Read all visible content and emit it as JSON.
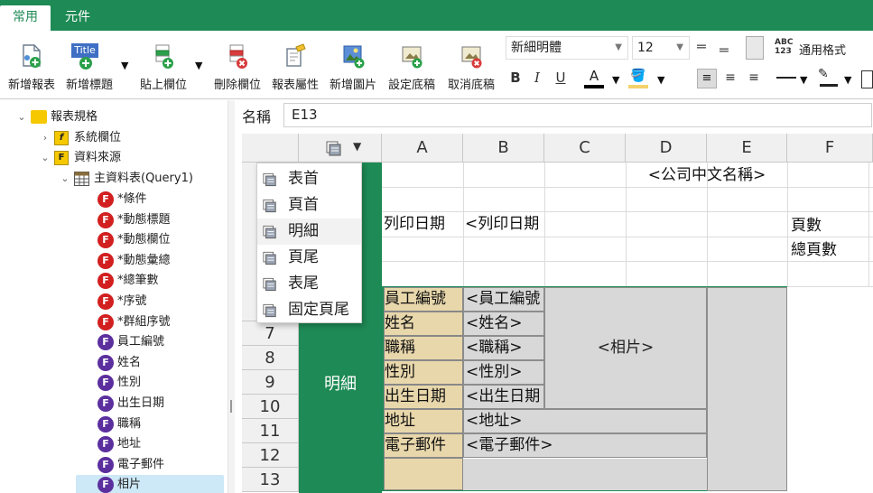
{
  "tabs": [
    {
      "label": "常用",
      "active": true
    },
    {
      "label": "元件",
      "active": false
    }
  ],
  "ribbon": {
    "buttons": [
      {
        "label": "新增報表",
        "icon": "new-report-icon"
      },
      {
        "label": "新增標題",
        "icon": "new-title-icon",
        "icon_text": "Title"
      },
      {
        "label": "貼上欄位",
        "icon": "paste-field-icon"
      },
      {
        "label": "刪除欄位",
        "icon": "delete-field-icon"
      },
      {
        "label": "報表屬性",
        "icon": "report-properties-icon"
      },
      {
        "label": "新增圖片",
        "icon": "add-image-icon"
      },
      {
        "label": "設定底稿",
        "icon": "set-template-icon"
      },
      {
        "label": "取消底稿",
        "icon": "cancel-template-icon"
      }
    ],
    "font_name": "新細明體",
    "font_size": "12",
    "format_icon_text": "ABC\n123",
    "format_label": "通用格式",
    "colors": {
      "font": "#000000",
      "fill": "#f5d26b",
      "brand": "#1e8a55"
    }
  },
  "tree": {
    "root": "報表規格",
    "system": "系統欄位",
    "datasource": "資料來源",
    "query": "主資料表(Query1)",
    "fields": [
      {
        "label": "*條件",
        "kind": "red"
      },
      {
        "label": "*動態標題",
        "kind": "red"
      },
      {
        "label": "*動態欄位",
        "kind": "red"
      },
      {
        "label": "*動態彙總",
        "kind": "red"
      },
      {
        "label": "*總筆數",
        "kind": "red"
      },
      {
        "label": "*序號",
        "kind": "red"
      },
      {
        "label": "*群組序號",
        "kind": "red"
      },
      {
        "label": "員工編號",
        "kind": "purple"
      },
      {
        "label": "姓名",
        "kind": "purple"
      },
      {
        "label": "性別",
        "kind": "purple"
      },
      {
        "label": "出生日期",
        "kind": "purple"
      },
      {
        "label": "職稱",
        "kind": "purple"
      },
      {
        "label": "地址",
        "kind": "purple"
      },
      {
        "label": "電子郵件",
        "kind": "purple"
      },
      {
        "label": "相片",
        "kind": "purple",
        "selected": true
      }
    ],
    "field_badge": "F"
  },
  "namebar": {
    "label": "名稱",
    "value": "E13"
  },
  "sheet": {
    "columns": [
      "A",
      "B",
      "C",
      "D",
      "E",
      "F"
    ],
    "row_numbers": [
      "7",
      "8",
      "9",
      "10",
      "11",
      "12",
      "13"
    ],
    "band_label": "明細",
    "company": "<公司中文名稱>",
    "print_date_label": "列印日期",
    "print_date_value": "<列印日期",
    "pages_label": "頁數",
    "total_pages_label": "總頁數",
    "photo": "<相片>",
    "detail_rows": [
      {
        "label": "員工編號",
        "value": "<員工編號"
      },
      {
        "label": "姓名",
        "value": "<姓名>"
      },
      {
        "label": "職稱",
        "value": "<職稱>"
      },
      {
        "label": "性別",
        "value": "<性別>"
      },
      {
        "label": "出生日期",
        "value": "<出生日期"
      },
      {
        "label": "地址",
        "value": "<地址>"
      },
      {
        "label": "電子郵件",
        "value": "<電子郵件>"
      }
    ]
  },
  "band_menu": {
    "items": [
      "表首",
      "頁首",
      "明細",
      "頁尾",
      "表尾",
      "固定頁尾"
    ],
    "highlighted_index": 2
  }
}
